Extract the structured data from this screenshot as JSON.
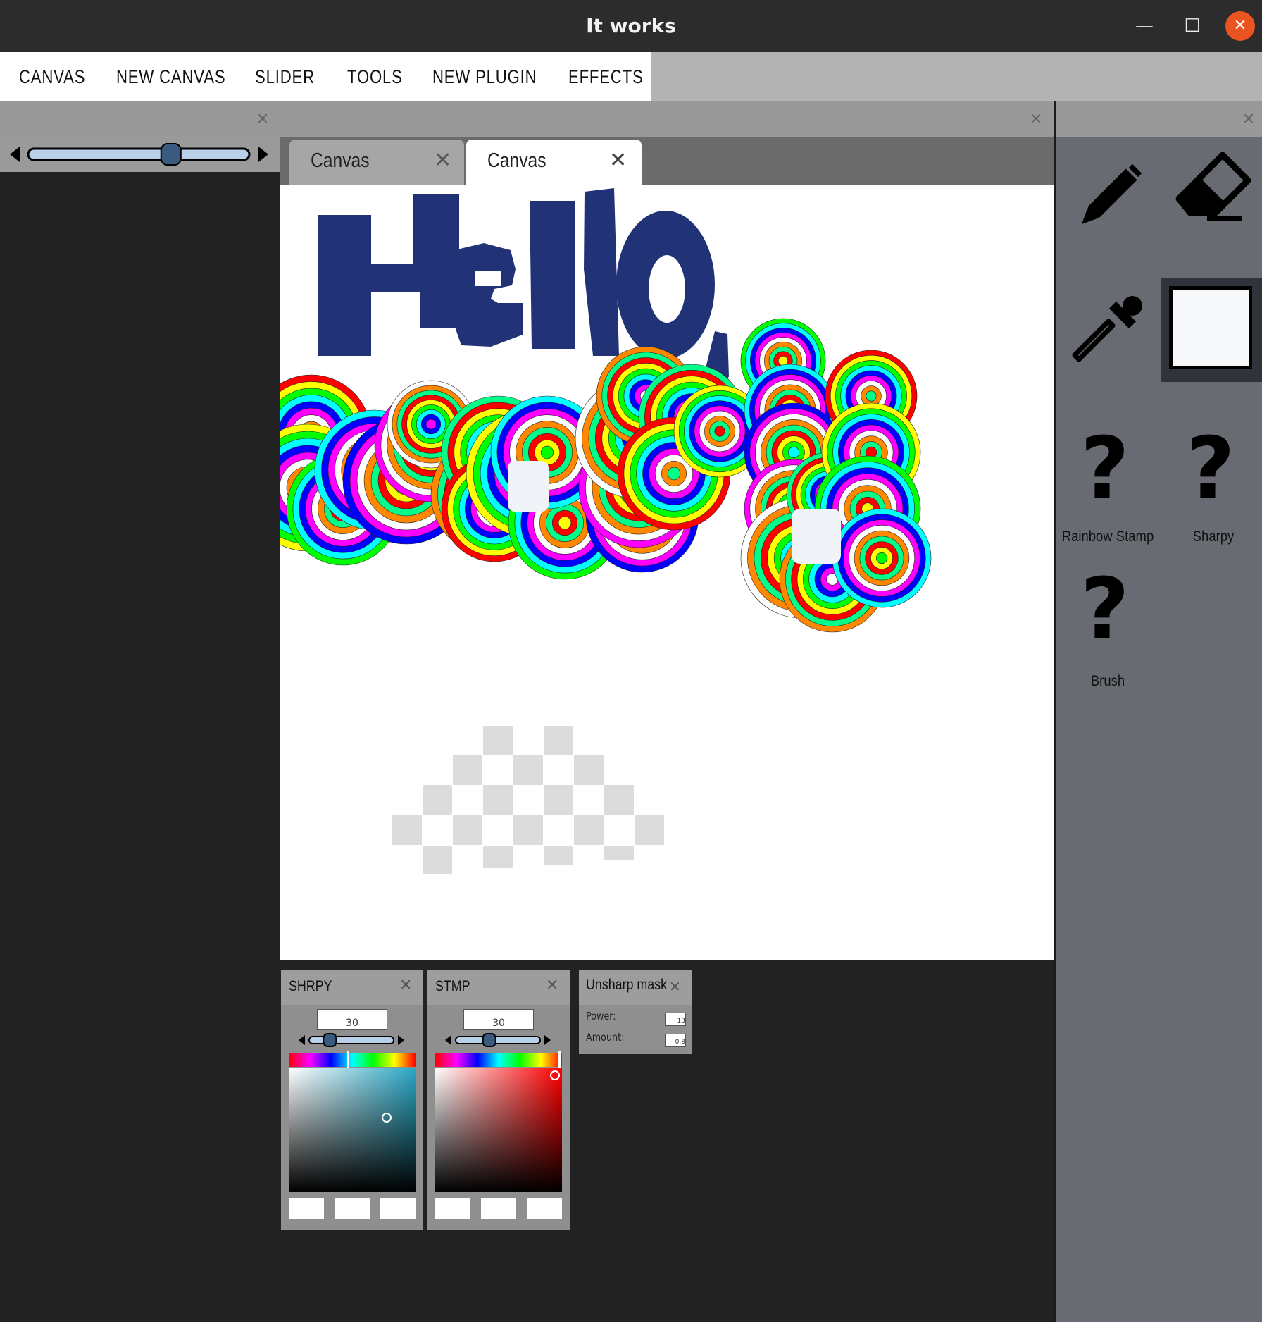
{
  "window": {
    "title": "It works",
    "controls": {
      "minimize": "—",
      "maximize": "☐",
      "close": "✕"
    },
    "close_color": "#e95420"
  },
  "menu": {
    "items": [
      "CANVAS",
      "NEW CANVAS",
      "SLIDER",
      "TOOLS",
      "NEW PLUGIN",
      "EFFECTS"
    ]
  },
  "left_panel": {
    "slider": {
      "value_fraction": 0.66
    }
  },
  "tabs": [
    {
      "label": "Canvas",
      "active": false
    },
    {
      "label": "Canvas",
      "active": true
    }
  ],
  "canvas": {
    "text_drawn": "Hello,",
    "ink_color": "#213376"
  },
  "tools": [
    {
      "name": "pencil",
      "icon": "pencil-icon",
      "label": ""
    },
    {
      "name": "eraser",
      "icon": "eraser-icon",
      "label": ""
    },
    {
      "name": "eyedropper",
      "icon": "eyedropper-icon",
      "label": ""
    },
    {
      "name": "color",
      "icon": "color-swatch",
      "label": ""
    },
    {
      "name": "rainbow-stamp",
      "icon": "question-icon",
      "label": "Rainbow Stamp"
    },
    {
      "name": "sharpy",
      "icon": "question-icon",
      "label": "Sharpy"
    },
    {
      "name": "brush",
      "icon": "question-icon",
      "label": "Brush"
    }
  ],
  "plugins": {
    "shrpy": {
      "title": "SHRPY",
      "value": "30",
      "slider_fraction": 0.2,
      "hue_color": "#2aa7c4"
    },
    "stmp": {
      "title": "STMP",
      "value": "30",
      "slider_fraction": 0.38,
      "hue_color": "#ff0000"
    },
    "unsharp": {
      "title": "Unsharp mask",
      "power_label": "Power:",
      "power_value": "13",
      "amount_label": "Amount:",
      "amount_value": "0.8"
    }
  }
}
